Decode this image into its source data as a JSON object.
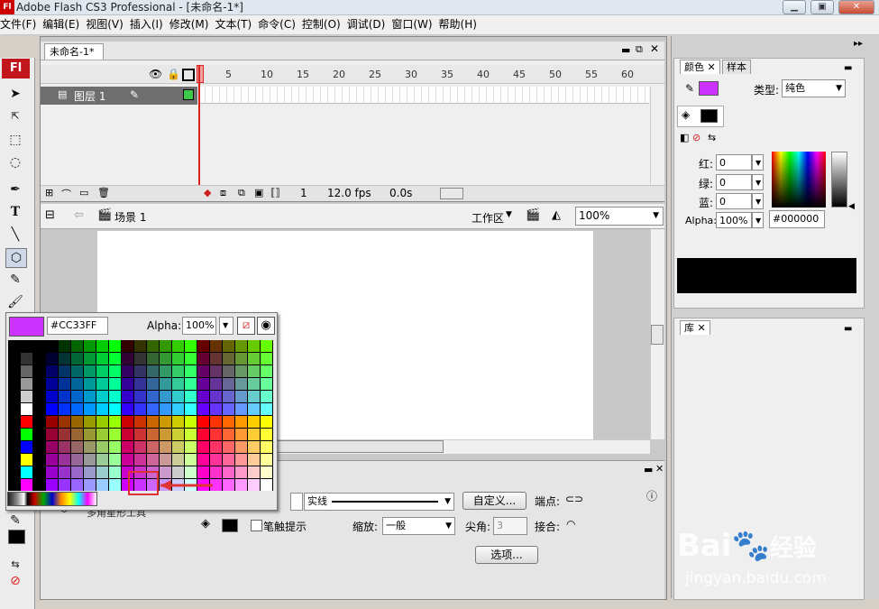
{
  "window": {
    "title": "Adobe Flash CS3 Professional - [未命名-1*]",
    "logo": "Fl"
  },
  "menu": [
    "文件(F)",
    "编辑(E)",
    "视图(V)",
    "插入(I)",
    "修改(M)",
    "文本(T)",
    "命令(C)",
    "控制(O)",
    "调试(D)",
    "窗口(W)",
    "帮助(H)"
  ],
  "document": {
    "tab": "未命名-1*",
    "scene": "场景 1",
    "workspace": "工作区",
    "zoom": "100%"
  },
  "timeline": {
    "frame_numbers": [
      "5",
      "10",
      "15",
      "20",
      "25",
      "30",
      "35",
      "40",
      "45",
      "50",
      "55",
      "60"
    ],
    "layer": "图层 1",
    "current_frame": "1",
    "fps": "12.0 fps",
    "time": "0.0s"
  },
  "swatch_popup": {
    "hex": "#CC33FF",
    "alpha_label": "Alpha:",
    "alpha": "100%",
    "selected_color": "#CC33FF"
  },
  "properties": {
    "stroke_style": "实线",
    "custom_button": "自定义...",
    "cap_label": "端点:",
    "stroke_hint": "笔触提示",
    "scale_label": "缩放:",
    "scale_value": "一般",
    "miter_label": "尖角:",
    "miter_value": "3",
    "join_label": "接合:",
    "options_button": "选项...",
    "tool_name": "多角星形工具"
  },
  "color_panel": {
    "tabs": [
      "颜色",
      "样本"
    ],
    "type_label": "类型:",
    "type_value": "纯色",
    "stroke_color": "#CC33FF",
    "fill_color": "#000000",
    "red_label": "红:",
    "red": "0",
    "green_label": "绿:",
    "green": "0",
    "blue_label": "蓝:",
    "blue": "0",
    "alpha_label": "Alpha:",
    "alpha": "100%",
    "hex": "#000000"
  },
  "library_panel": {
    "tab": "库"
  },
  "watermark": {
    "brand": "Bai",
    "brand_cn": "经验",
    "url": "jingyan.baidu.com"
  }
}
